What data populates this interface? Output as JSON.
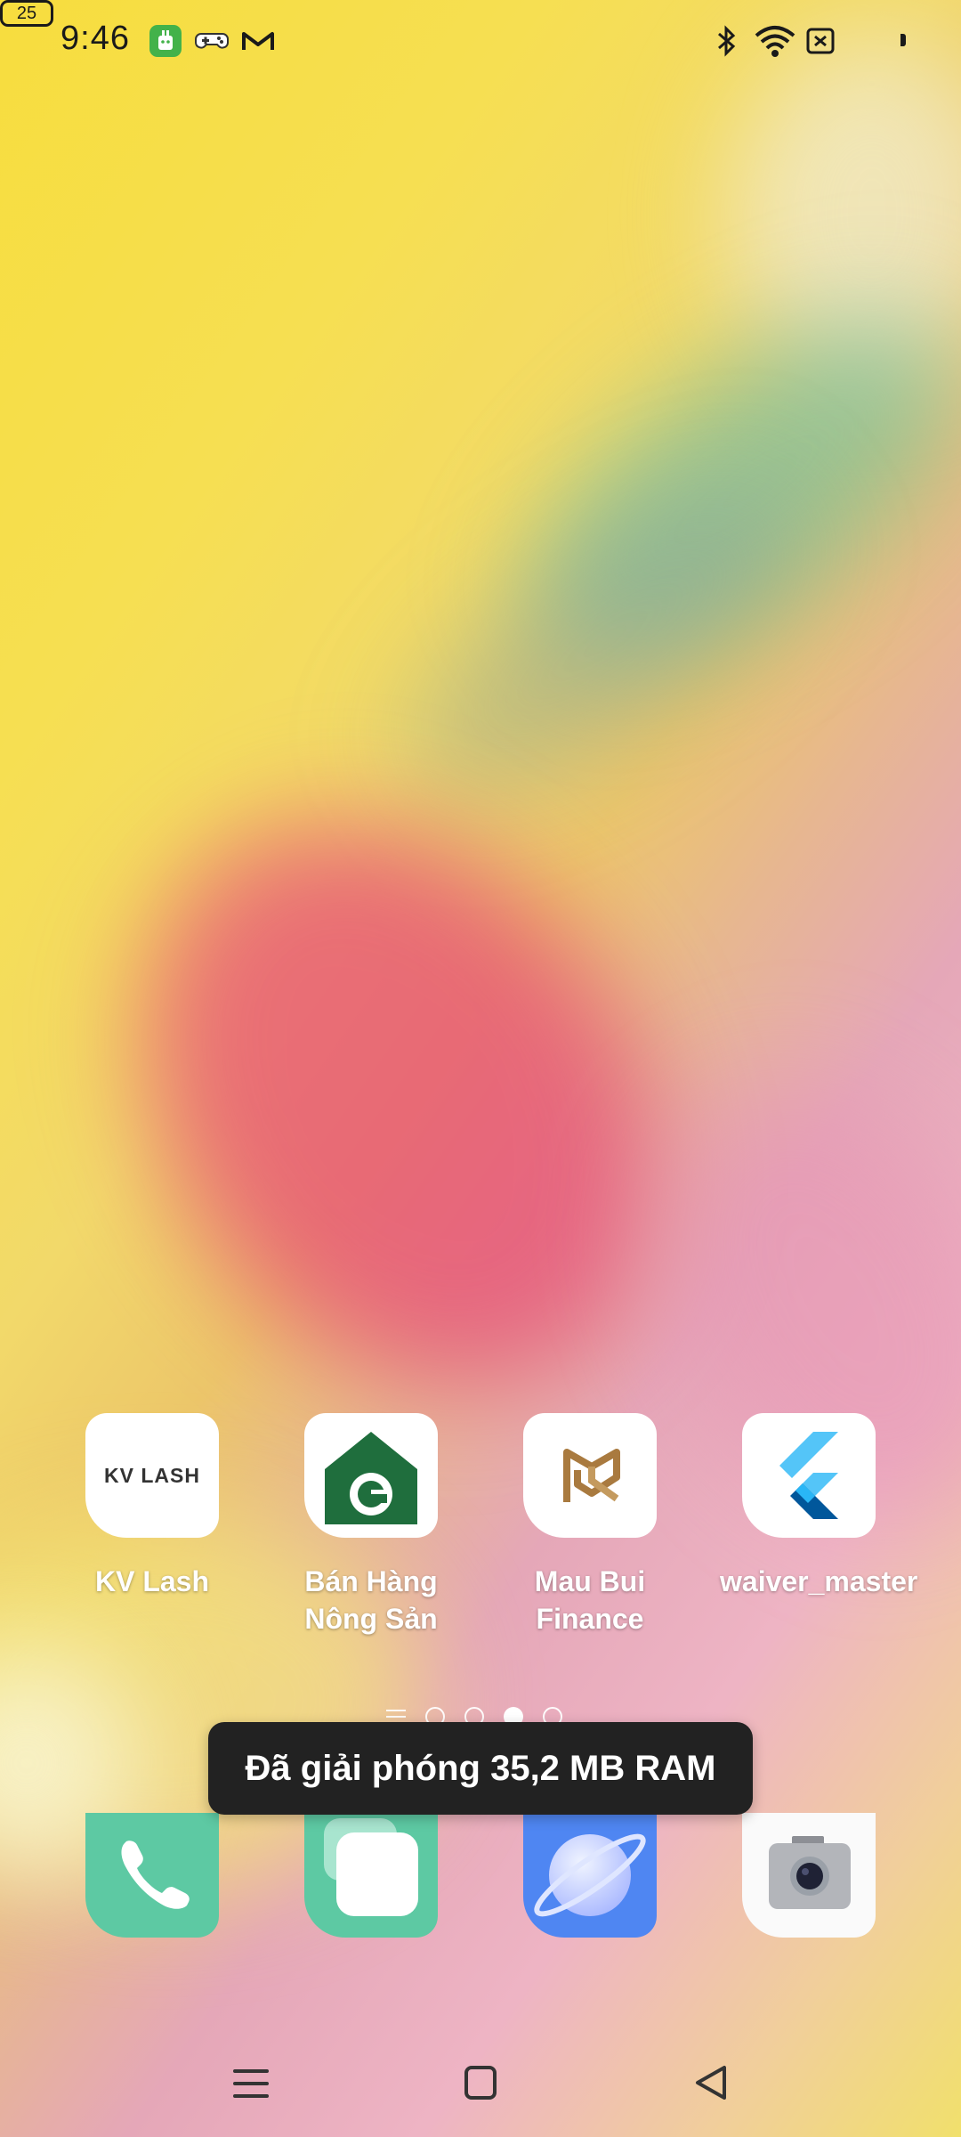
{
  "status_bar": {
    "time": "9:46",
    "battery_level": "25"
  },
  "home_apps": [
    {
      "label": "KV Lash",
      "icon_text": "KV LASH",
      "icon": "kv-lash-icon"
    },
    {
      "label": "Bán Hàng\nNông Sản",
      "icon": "ban-hang-nong-san-icon"
    },
    {
      "label": "Mau Bui\nFinance",
      "icon": "mau-bui-finance-icon"
    },
    {
      "label": "waiver_master",
      "icon": "flutter-icon"
    }
  ],
  "toast": {
    "message": "Đã giải phóng 35,2 MB RAM"
  },
  "pager": {
    "page_count": 4,
    "active_page": 3
  },
  "dock": [
    {
      "name": "phone-icon"
    },
    {
      "name": "messages-icon"
    },
    {
      "name": "browser-icon"
    },
    {
      "name": "camera-icon"
    }
  ],
  "colors": {
    "toast_bg": "#222222",
    "dock_green": "#5dc9a3",
    "browser_blue": "#4f86f2"
  }
}
